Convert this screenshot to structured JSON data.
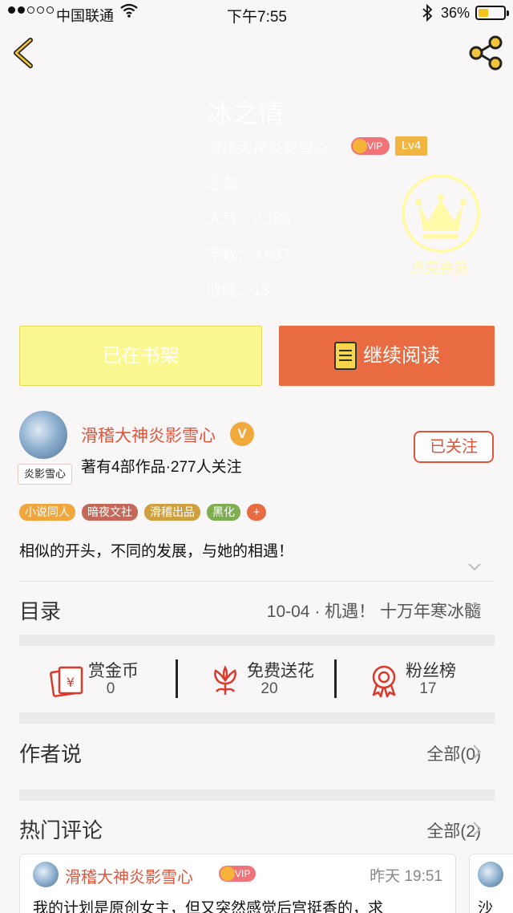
{
  "status_bar": {
    "carrier": "中国联通",
    "time": "下午7:55",
    "battery": "36%"
  },
  "book": {
    "title": "冰之情",
    "author": "滑稽大神炎影雪心",
    "vip": "VIP",
    "level": "Lv4",
    "status": "连载",
    "popularity": "人气：2,188",
    "word_count": "字数：3,637",
    "collections": "收藏：13",
    "member_label": "点亮会员"
  },
  "actions": {
    "shelf": "已在书架",
    "read": "继续阅读"
  },
  "author_card": {
    "name": "滑稽大神炎影雪心",
    "badge": "V",
    "avatar_tag": "炎影雪心",
    "info": "著有4部作品·277人关注",
    "follow": "已关注"
  },
  "tags": [
    {
      "label": "小说同人",
      "color": "#f0a63c"
    },
    {
      "label": "暗夜文社",
      "color": "#c4685a"
    },
    {
      "label": "滑稽出品",
      "color": "#cfa040"
    },
    {
      "label": "黑化",
      "color": "#7fae52"
    },
    {
      "label": "+",
      "color": "#e86b41"
    }
  ],
  "description": "相似的开头，不同的发展，与她的相遇！",
  "catalog": {
    "label": "目录",
    "latest": "10-04 · 机遇！ 十万年寒冰髓"
  },
  "stats": [
    {
      "label": "赏金币",
      "value": "0",
      "icon": "red-envelope-icon"
    },
    {
      "label": "免费送花",
      "value": "20",
      "icon": "flower-icon"
    },
    {
      "label": "粉丝榜",
      "value": "17",
      "icon": "ribbon-award-icon"
    }
  ],
  "author_say": {
    "label": "作者说",
    "all": "全部(0)"
  },
  "hot_comments": {
    "label": "热门评论",
    "all": "全部(2)"
  },
  "comment": {
    "name": "滑稽大神炎影雪心",
    "vip": "VIP",
    "time": "昨天  19:51",
    "text": "我的计划是原创女主，但又突然感觉后宫挺香的，求"
  },
  "comment2_text": "沙",
  "colors": {
    "accent": "#e0553a",
    "read_button": "#e86b41",
    "shelf_button": "#fbf891"
  }
}
